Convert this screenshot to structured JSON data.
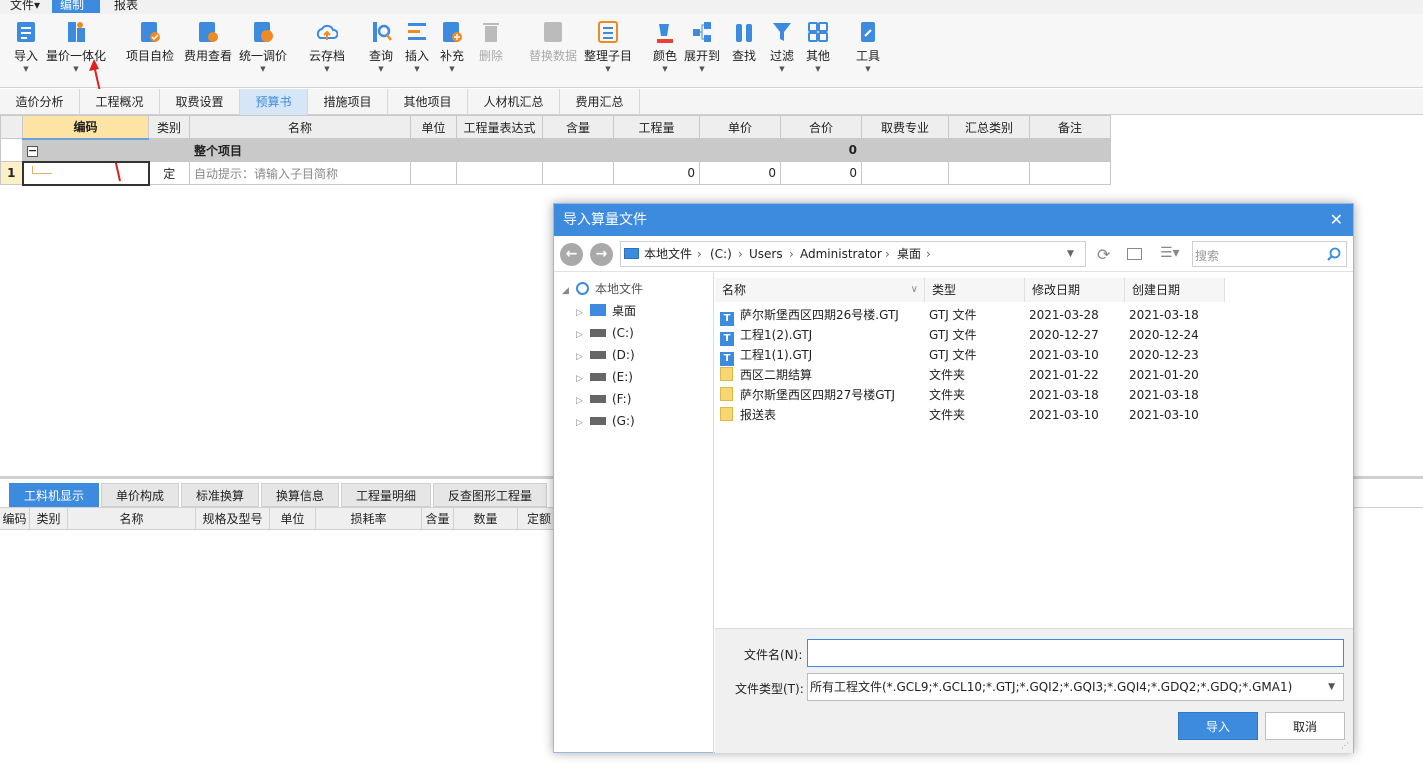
{
  "menu": {
    "items": [
      "文件▾",
      "编制",
      "报表"
    ]
  },
  "toolbar": {
    "buttons": [
      {
        "label": "导入",
        "dropdown": true
      },
      {
        "label": "量价一体化",
        "dropdown": true
      },
      {
        "label": "项目自检"
      },
      {
        "label": "费用查看"
      },
      {
        "label": "统一调价",
        "dropdown": true
      },
      {
        "label": "云存档",
        "dropdown": true
      },
      {
        "label": "查询",
        "dropdown": true
      },
      {
        "label": "插入",
        "dropdown": true
      },
      {
        "label": "补充",
        "dropdown": true
      },
      {
        "label": "删除",
        "disabled": true
      },
      {
        "label": "替换数据",
        "disabled": true
      },
      {
        "label": "整理子目",
        "dropdown": true
      },
      {
        "label": "颜色",
        "dropdown": true
      },
      {
        "label": "展开到",
        "dropdown": true
      },
      {
        "label": "查找"
      },
      {
        "label": "过滤",
        "dropdown": true
      },
      {
        "label": "其他",
        "dropdown": true
      },
      {
        "label": "工具",
        "dropdown": true
      }
    ],
    "accent": "#3d8bde"
  },
  "tabs": [
    "造价分析",
    "工程概况",
    "取费设置",
    "预算书",
    "措施项目",
    "其他项目",
    "人材机汇总",
    "费用汇总"
  ],
  "active_tab": "预算书",
  "grid": {
    "columns": [
      "编码",
      "类别",
      "名称",
      "单位",
      "工程量表达式",
      "含量",
      "工程量",
      "单价",
      "合价",
      "取费专业",
      "汇总类别",
      "备注"
    ],
    "group_row": {
      "toggle": "−",
      "name": "整个项目",
      "total": "0"
    },
    "rows": [
      {
        "index": "1",
        "type": "定",
        "name_hint": "自动提示：请输入子目简称",
        "quantity": "0",
        "price": "0",
        "total": "0"
      }
    ]
  },
  "bottom_tabs": [
    "工料机显示",
    "单价构成",
    "标准换算",
    "换算信息",
    "工程量明细",
    "反查图形工程量"
  ],
  "bottom_columns": [
    "编码",
    "类别",
    "名称",
    "规格及型号",
    "单位",
    "损耗率",
    "含量",
    "数量",
    "定额"
  ],
  "dialog": {
    "title": "导入算量文件",
    "close": "✕",
    "back": "←",
    "forward": "→",
    "path": [
      "本地文件",
      "(C:)",
      "Users",
      "Administrator",
      "桌面"
    ],
    "search_placeholder": "搜索",
    "tree": [
      {
        "label": "本地文件",
        "level": 0
      },
      {
        "label": "桌面",
        "level": 1,
        "selected": true
      },
      {
        "label": "(C:)",
        "level": 1
      },
      {
        "label": "(D:)",
        "level": 1
      },
      {
        "label": "(E:)",
        "level": 1
      },
      {
        "label": "(F:)",
        "level": 1
      },
      {
        "label": "(G:)",
        "level": 1
      }
    ],
    "columns": [
      "名称",
      "类型",
      "修改日期",
      "创建日期"
    ],
    "files": [
      {
        "name": "萨尔斯堡西区四期26号楼.GTJ",
        "type": "GTJ 文件",
        "modified": "2021-03-28",
        "created": "2021-03-18",
        "kind": "gtj"
      },
      {
        "name": "工程1(2).GTJ",
        "type": "GTJ 文件",
        "modified": "2020-12-27",
        "created": "2020-12-24",
        "kind": "gtj"
      },
      {
        "name": "工程1(1).GTJ",
        "type": "GTJ 文件",
        "modified": "2021-03-10",
        "created": "2020-12-23",
        "kind": "gtj"
      },
      {
        "name": "西区二期结算",
        "type": "文件夹",
        "modified": "2021-01-22",
        "created": "2021-01-20",
        "kind": "folder"
      },
      {
        "name": "萨尔斯堡西区四期27号楼GTJ",
        "type": "文件夹",
        "modified": "2021-03-18",
        "created": "2021-03-18",
        "kind": "folder"
      },
      {
        "name": "报送表",
        "type": "文件夹",
        "modified": "2021-03-10",
        "created": "2021-03-10",
        "kind": "folder"
      }
    ],
    "filename_label": "文件名(N):",
    "filename_value": "",
    "filetype_label": "文件类型(T):",
    "filetype_value": "所有工程文件(*.GCL9;*.GCL10;*.GTJ;*.GQI2;*.GQI3;*.GQI4;*.GDQ2;*.GDQ;*.GMA1)",
    "import_label": "导入",
    "cancel_label": "取消"
  }
}
